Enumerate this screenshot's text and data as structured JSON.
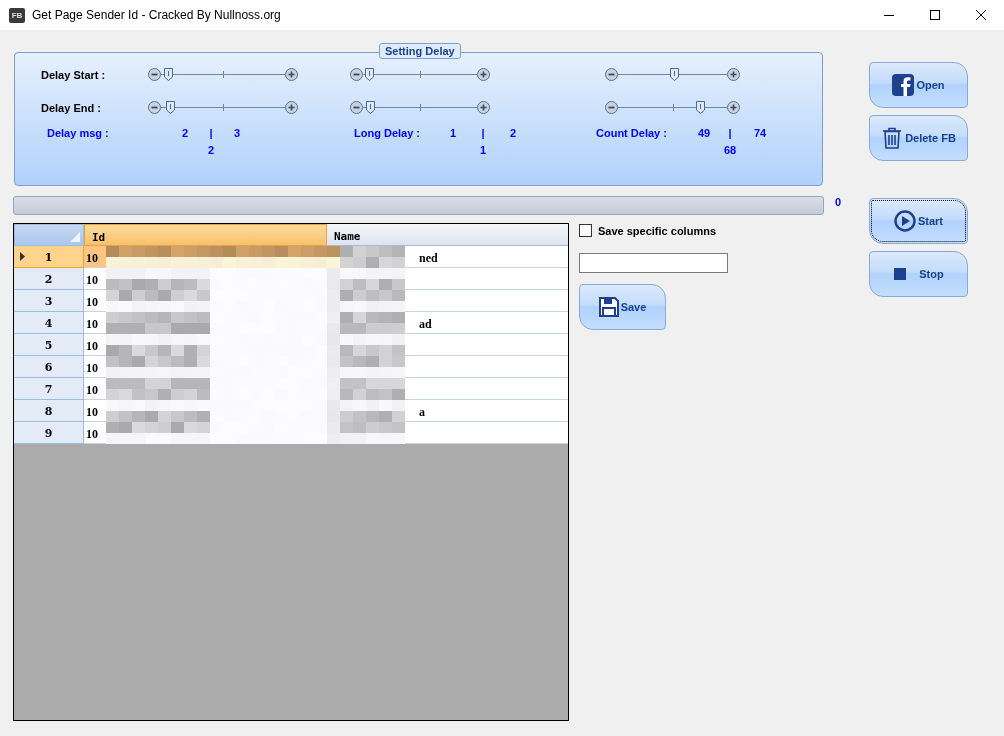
{
  "window": {
    "app_icon": "FB",
    "title": "Get Page Sender Id - Cracked By Nullnoss.org"
  },
  "setting_delay": {
    "title": "Setting Delay",
    "row_labels": [
      "Delay Start :",
      "Delay End :"
    ],
    "slider_groups": [
      {
        "sliders": [
          {
            "level": 0.02
          },
          {
            "level": 0.03
          }
        ],
        "label": "Delay msg :",
        "min": "2",
        "separator": "|",
        "max": "3",
        "current": "2"
      },
      {
        "sliders": [
          {
            "level": 0.01
          },
          {
            "level": 0.02
          }
        ],
        "label": "Long Delay :",
        "min": "1",
        "separator": "|",
        "max": "2",
        "current": "1"
      },
      {
        "sliders": [
          {
            "level": 0.49
          },
          {
            "level": 0.74
          }
        ],
        "label": "Count Delay :",
        "min": "49",
        "separator": "|",
        "max": "74",
        "current": "68"
      }
    ]
  },
  "progress": {
    "level": 0,
    "reading": "0"
  },
  "table": {
    "columns": [
      "Id",
      "Name"
    ],
    "rows": [
      {
        "number": "1",
        "selected": true,
        "id": "10",
        "name": "ned"
      },
      {
        "number": "2",
        "selected": false,
        "id": "10"
      },
      {
        "number": "3",
        "selected": false,
        "id": "10"
      },
      {
        "number": "4",
        "selected": false,
        "id": "10",
        "name": "ad"
      },
      {
        "number": "5",
        "selected": false,
        "id": "10"
      },
      {
        "number": "6",
        "selected": false,
        "id": "10"
      },
      {
        "number": "7",
        "selected": false,
        "id": "10"
      },
      {
        "number": "8",
        "selected": false,
        "id": "10",
        "name": "a"
      },
      {
        "number": "9",
        "selected": false,
        "id": "10"
      }
    ]
  },
  "save_panel": {
    "checkbox": {
      "label": "Save specific columns",
      "checked": false
    },
    "save_button": {
      "label": "Save"
    }
  },
  "buttons": [
    {
      "label": "Open",
      "kind": "facebook",
      "focused": false
    },
    {
      "label": "Delete FB",
      "kind": "trash",
      "focused": false
    },
    {
      "label": "Start",
      "kind": "play",
      "focused": true
    },
    {
      "label": "Stop",
      "kind": "stop",
      "focused": false
    }
  ]
}
